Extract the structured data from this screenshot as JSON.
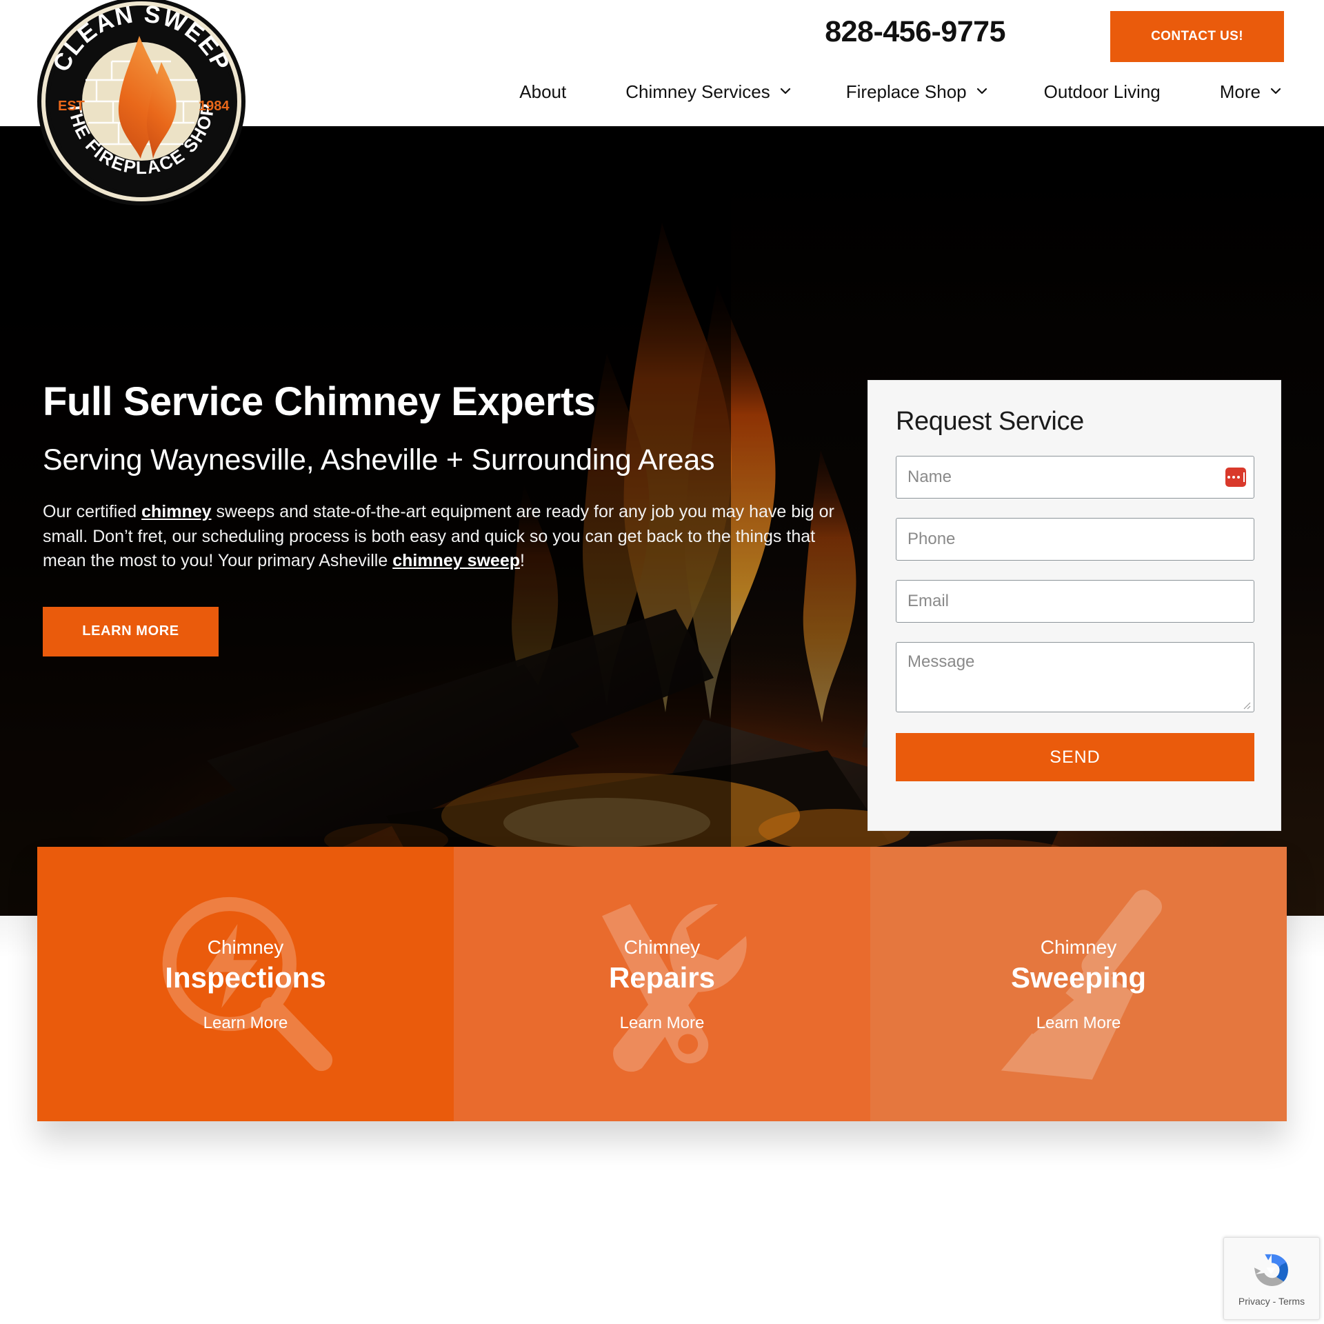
{
  "header": {
    "logo": {
      "top_text": "CLEAN SWEEP",
      "bottom_text": "THE FIREPLACE SHOP",
      "est_label": "EST",
      "year": "1984",
      "icon": "flame-brick-logo"
    },
    "phone": "828-456-9775",
    "contact_button": "CONTACT US!",
    "nav": [
      {
        "label": "About",
        "has_dropdown": false
      },
      {
        "label": "Chimney Services",
        "has_dropdown": true
      },
      {
        "label": "Fireplace Shop",
        "has_dropdown": true
      },
      {
        "label": "Outdoor Living",
        "has_dropdown": false
      },
      {
        "label": "More",
        "has_dropdown": true
      }
    ]
  },
  "hero": {
    "heading": "Full Service Chimney Experts",
    "subheading": "Serving Waynesville, Asheville + Surrounding Areas",
    "paragraph_part1": "Our certified ",
    "link1": "chimney",
    "paragraph_part2": " sweeps and state-of-the-art equipment are ready for any job you may have big or small. Don’t fret, our scheduling process is both easy and quick so you can get back to the things that mean the most to you! Your primary Asheville ",
    "link2": "chimney sweep",
    "paragraph_part3": "!",
    "cta_button": "LEARN MORE"
  },
  "form": {
    "title": "Request Service",
    "name_placeholder": "Name",
    "phone_placeholder": "Phone",
    "email_placeholder": "Email",
    "message_placeholder": "Message",
    "submit_label": "SEND",
    "autofill_icon": "password-manager-icon"
  },
  "service_cards": [
    {
      "kicker": "Chimney",
      "title": "Inspections",
      "link": "Learn More",
      "icon": "magnifier-bolt-icon",
      "color": "#EA5B0C"
    },
    {
      "kicker": "Chimney",
      "title": "Repairs",
      "link": "Learn More",
      "icon": "wrench-screwdriver-icon",
      "color": "#E96B2D"
    },
    {
      "kicker": "Chimney",
      "title": "Sweeping",
      "link": "Learn More",
      "icon": "broom-icon",
      "color": "#E5773E"
    }
  ],
  "recaptcha": {
    "text": "Privacy - Terms",
    "icon": "recaptcha-icon"
  },
  "colors": {
    "accent_orange": "#EA5B0C",
    "card_orange_2": "#E96B2D",
    "card_orange_3": "#E5773E",
    "hero_dark": "#050403",
    "autofill_red": "#D9392B"
  }
}
